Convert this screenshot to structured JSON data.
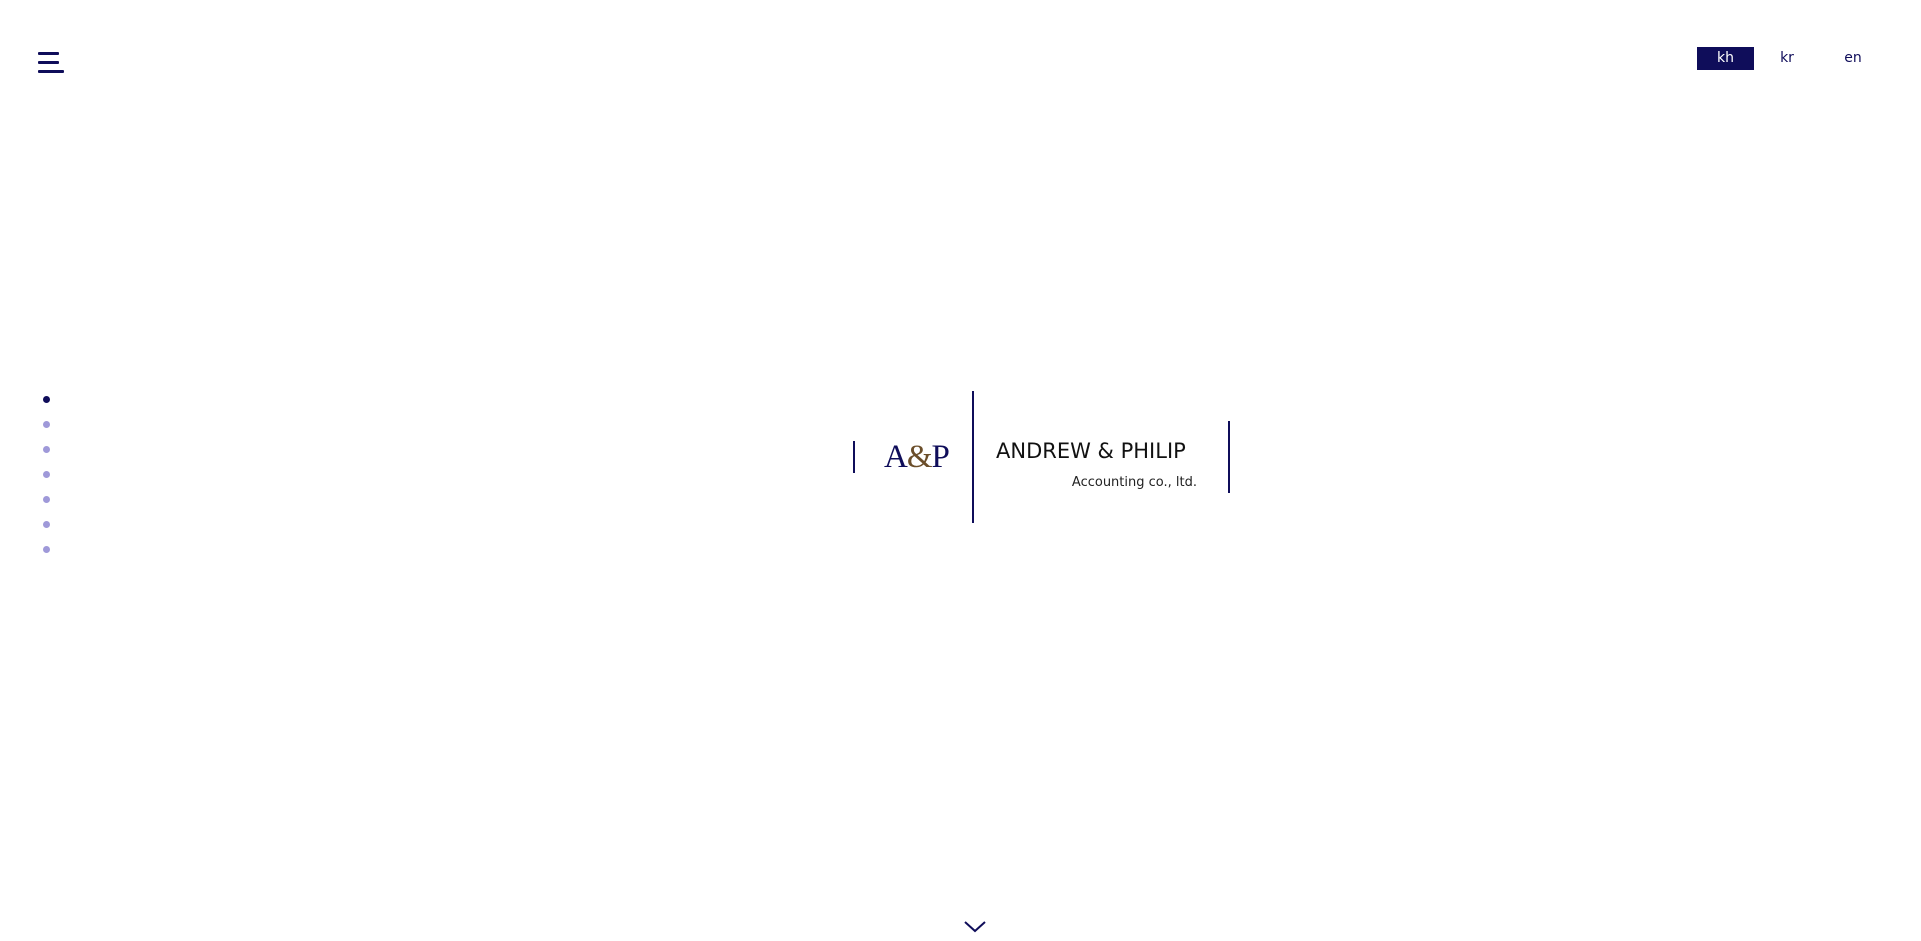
{
  "header": {
    "menu_icon": "hamburger-icon",
    "languages": [
      {
        "code": "kh",
        "label": "kh",
        "active": true
      },
      {
        "code": "kr",
        "label": "kr",
        "active": false
      },
      {
        "code": "en",
        "label": "en",
        "active": false
      }
    ]
  },
  "section_nav": {
    "count": 7,
    "active_index": 0
  },
  "logo": {
    "monogram_a": "A",
    "monogram_amp": "&",
    "monogram_p": "P",
    "company_name": "ANDREW & PHILIP",
    "company_subtitle": "Accounting co., ltd."
  },
  "scroll": {
    "icon": "chevron-down-icon"
  },
  "colors": {
    "brand_navy": "#0f0d5a",
    "dot_inactive": "#9f99d9",
    "ampersand_brown": "#6b4e2a",
    "background": "#ffffff"
  }
}
